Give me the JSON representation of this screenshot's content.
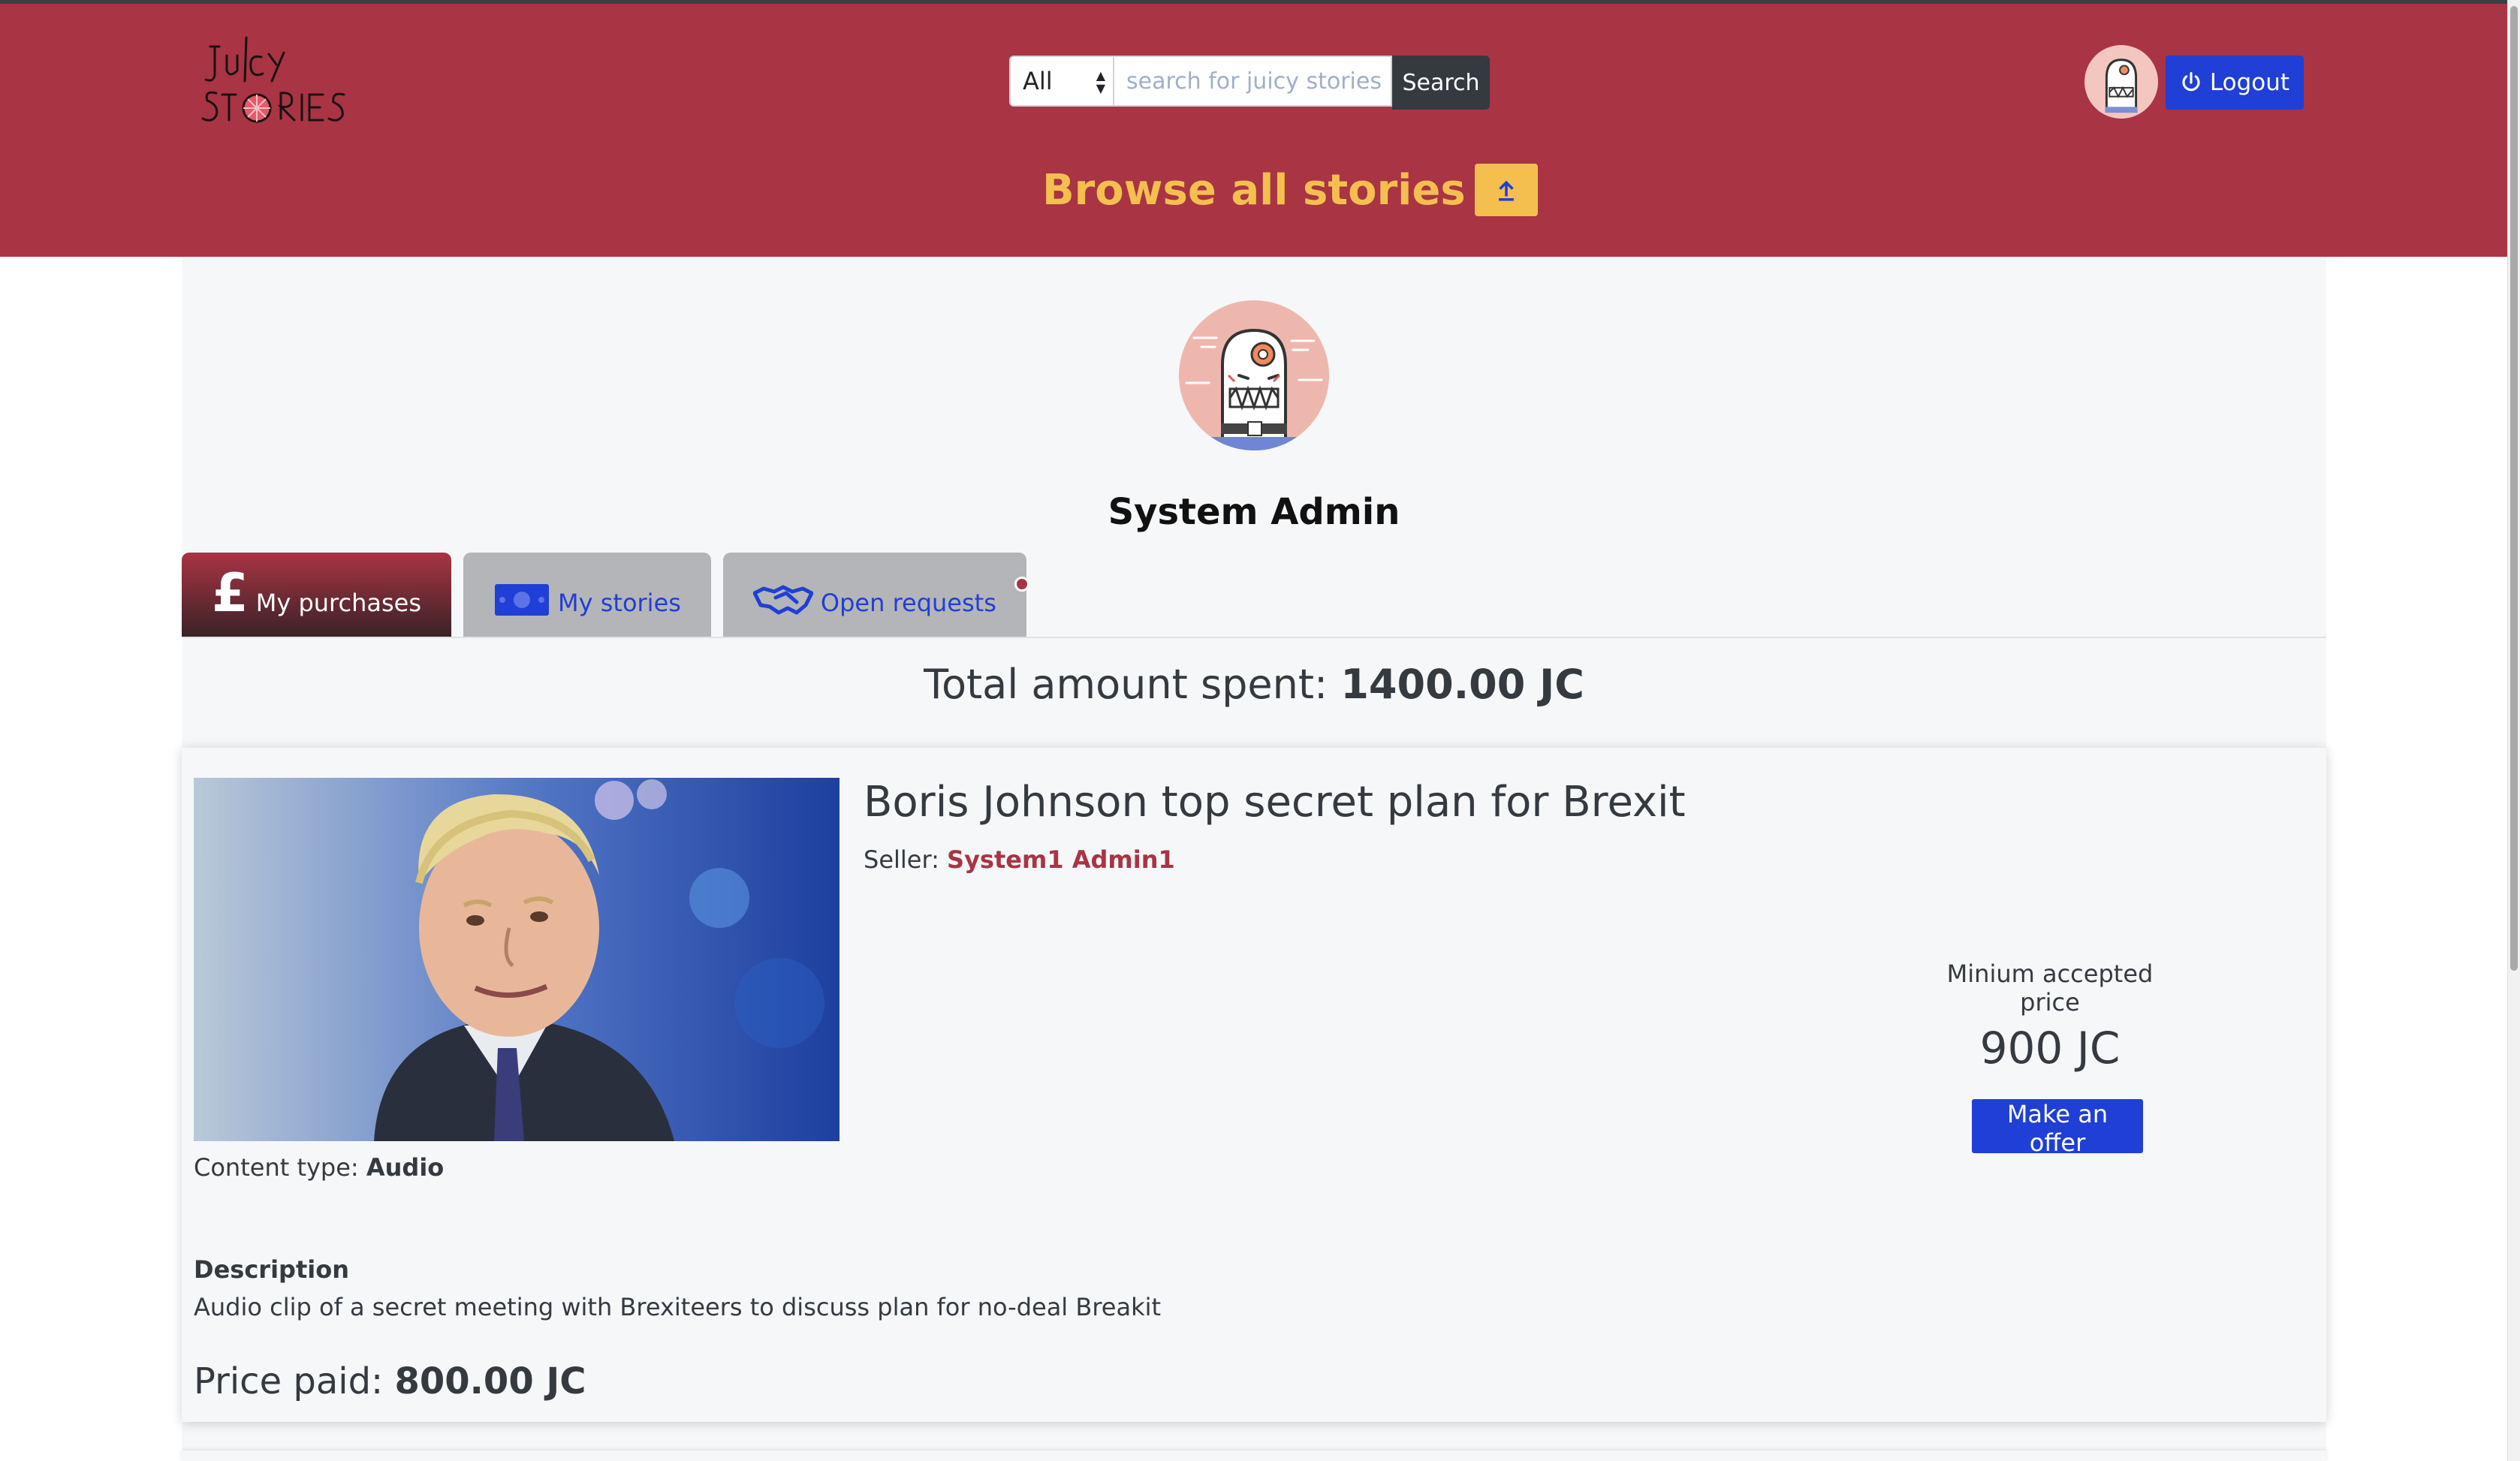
{
  "header": {
    "logo_alt": "Juicy Stories",
    "search": {
      "category_selected": "All",
      "placeholder": "search for juicy stories",
      "value": "",
      "button_label": "Search"
    },
    "logout_label": "Logout",
    "browse_label": "Browse all stories"
  },
  "profile": {
    "name": "System Admin"
  },
  "tabs": [
    {
      "label": "My purchases",
      "icon": "pound-icon",
      "active": true
    },
    {
      "label": "My stories",
      "icon": "banknote-icon",
      "active": false
    },
    {
      "label": "Open requests",
      "icon": "handshake-icon",
      "active": false,
      "has_notification": true
    }
  ],
  "summary": {
    "total_label": "Total amount spent:",
    "total_value": "1400.00 JC"
  },
  "purchases": [
    {
      "title": "Boris Johnson top secret plan for Brexit",
      "seller_label": "Seller:",
      "seller_name": "System1 Admin1",
      "content_type_label": "Content type:",
      "content_type": "Audio",
      "description_label": "Description",
      "description": "Audio clip of a secret meeting with Brexiteers to discuss plan for no-deal Breakit",
      "price_paid_label": "Price paid:",
      "price_paid": "800.00 JC",
      "min_price_label": "Minium accepted price",
      "min_price": "900 JC",
      "offer_button_label": "Make an offer"
    }
  ],
  "colors": {
    "brand": "#a93444",
    "accent_yellow": "#f4bf4f",
    "primary_blue": "#1f3fd6",
    "dark": "#343a40"
  }
}
